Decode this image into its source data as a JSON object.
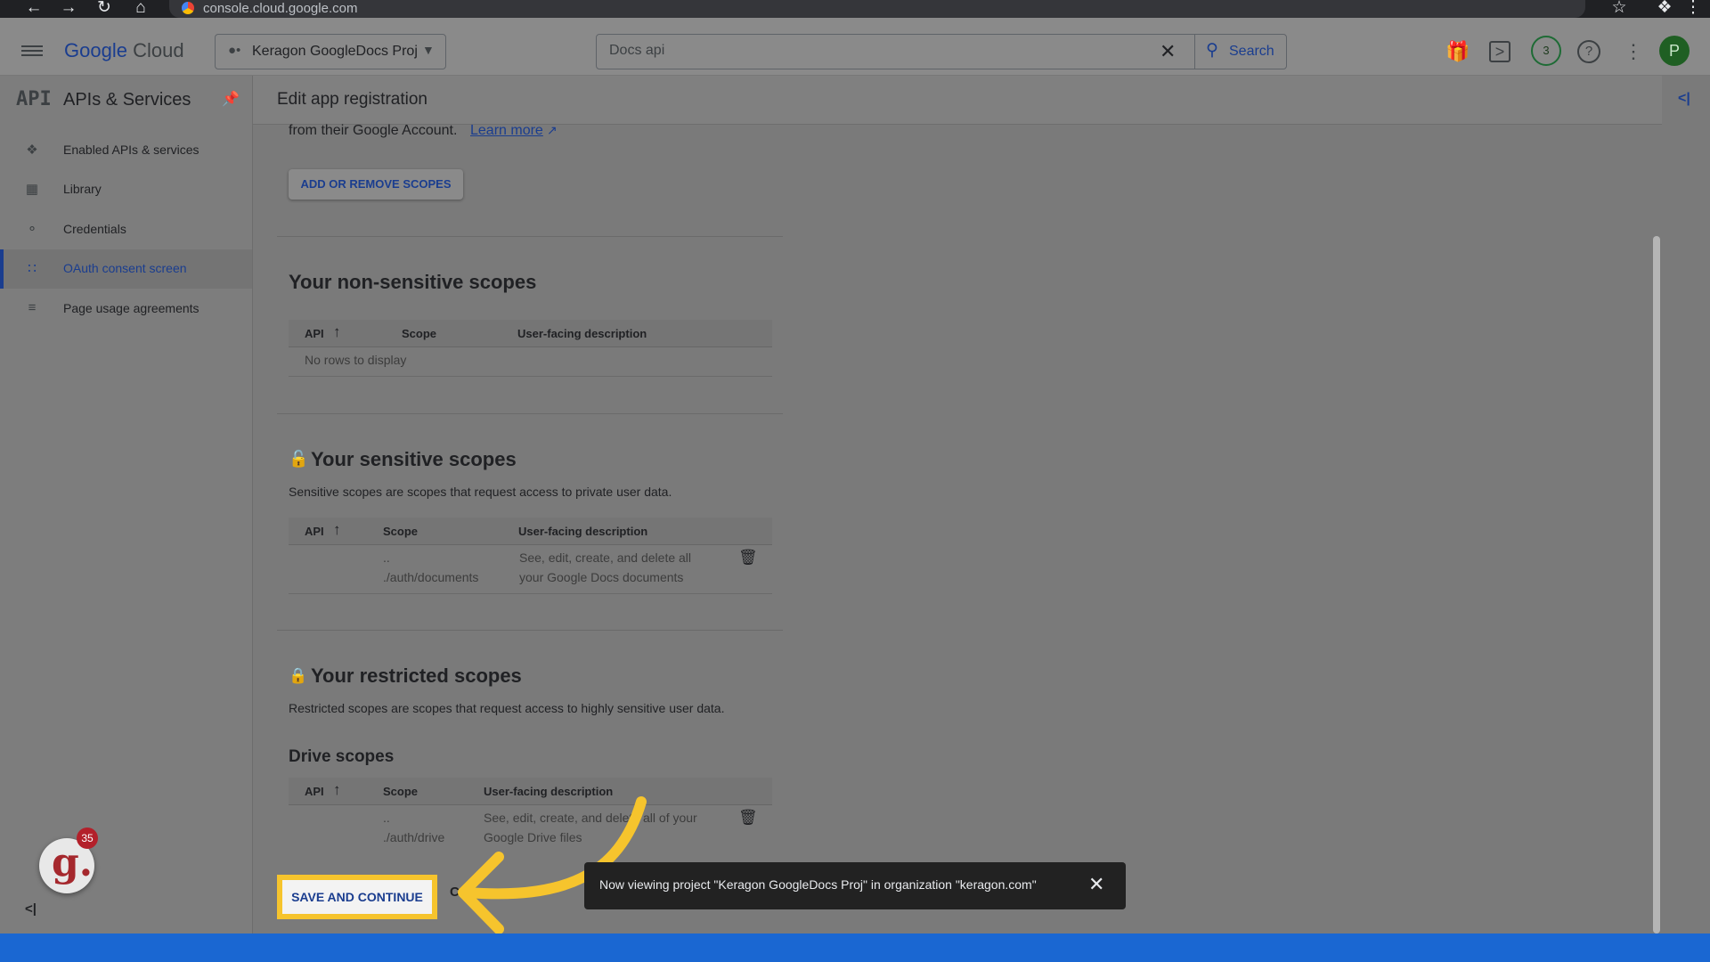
{
  "browser": {
    "url": "console.cloud.google.com"
  },
  "topbar": {
    "logo": {
      "google": "Google",
      "cloud": "Cloud"
    },
    "project": "Keragon GoogleDocs Proj",
    "search": {
      "value": "Docs api",
      "button": "Search"
    },
    "notifications": "3",
    "avatar": "P"
  },
  "sidebar": {
    "api_badge": "API",
    "title": "APIs & Services",
    "items": [
      {
        "label": "Enabled APIs & services",
        "icon": "services-icon"
      },
      {
        "label": "Library",
        "icon": "library-icon"
      },
      {
        "label": "Credentials",
        "icon": "key-icon"
      },
      {
        "label": "OAuth consent screen",
        "icon": "consent-icon",
        "active": true
      },
      {
        "label": "Page usage agreements",
        "icon": "settings-list-icon"
      }
    ],
    "extension_badge": "35"
  },
  "main": {
    "title": "Edit app registration",
    "intro_text": "from their Google Account.",
    "learn_more": "Learn more",
    "add_remove_scopes": "ADD OR REMOVE SCOPES",
    "non_sensitive": {
      "title": "Your non-sensitive scopes",
      "columns": [
        "API",
        "Scope",
        "User-facing description"
      ],
      "empty": "No rows to display"
    },
    "sensitive": {
      "title": "Your sensitive scopes",
      "desc": "Sensitive scopes are scopes that request access to private user data.",
      "columns": [
        "API",
        "Scope",
        "User-facing description"
      ],
      "rows": [
        {
          "api": "",
          "scope_1": "..",
          "scope_2": "./auth/documents",
          "desc_1": "See, edit, create, and delete all",
          "desc_2": "your Google Docs documents"
        }
      ]
    },
    "restricted": {
      "title": "Your restricted scopes",
      "desc": "Restricted scopes are scopes that request access to highly sensitive user data.",
      "drive_title": "Drive scopes",
      "columns": [
        "API",
        "Scope",
        "User-facing description"
      ],
      "rows": [
        {
          "api": "",
          "scope_1": "..",
          "scope_2": "./auth/drive",
          "desc_1": "See, edit, create, and delete all of your",
          "desc_2": "Google Drive files"
        }
      ]
    },
    "save_button": "SAVE AND CONTINUE",
    "cancel_partial": "C"
  },
  "snackbar": {
    "text": "Now viewing project \"Keragon GoogleDocs Proj\" in organization \"keragon.com\""
  },
  "colors": {
    "highlight": "#f6c42d",
    "accent": "#1a3d8f",
    "bottom_bar": "#1a67d2"
  }
}
